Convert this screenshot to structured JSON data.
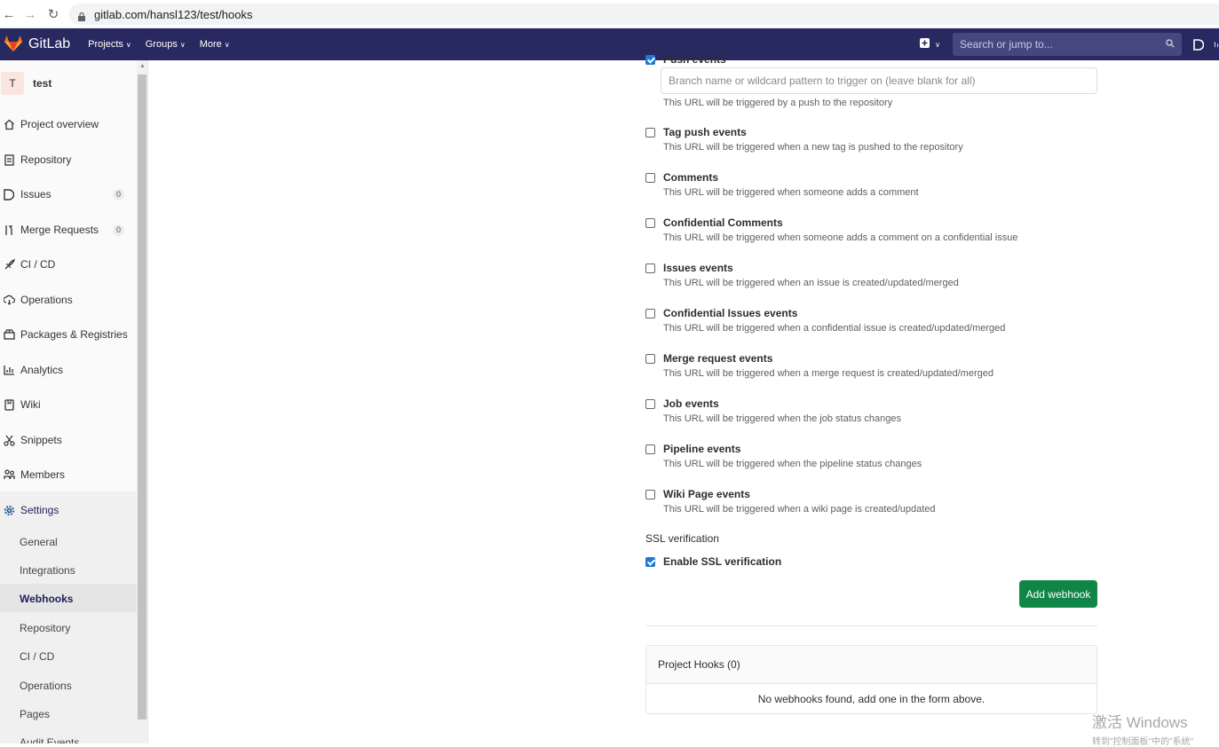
{
  "browser": {
    "url": "gitlab.com/hansl123/test/hooks"
  },
  "navbar": {
    "brand": "GitLab",
    "menus": [
      "Projects",
      "Groups",
      "More"
    ],
    "search_placeholder": "Search or jump to..."
  },
  "sidebar": {
    "project_initial": "T",
    "project_name": "test",
    "items": [
      {
        "label": "Project overview",
        "icon": "home-icon"
      },
      {
        "label": "Repository",
        "icon": "doc-icon"
      },
      {
        "label": "Issues",
        "icon": "issues-icon",
        "count": "0"
      },
      {
        "label": "Merge Requests",
        "icon": "merge-icon",
        "count": "0"
      },
      {
        "label": "CI / CD",
        "icon": "rocket-icon"
      },
      {
        "label": "Operations",
        "icon": "cloud-icon"
      },
      {
        "label": "Packages & Registries",
        "icon": "package-icon"
      },
      {
        "label": "Analytics",
        "icon": "chart-icon"
      },
      {
        "label": "Wiki",
        "icon": "book-icon"
      },
      {
        "label": "Snippets",
        "icon": "scissors-icon"
      },
      {
        "label": "Members",
        "icon": "users-icon"
      },
      {
        "label": "Settings",
        "icon": "gear-icon"
      }
    ],
    "settings_sub": [
      "General",
      "Integrations",
      "Webhooks",
      "Repository",
      "CI / CD",
      "Operations",
      "Pages",
      "Audit Events"
    ],
    "active_sub": "Webhooks"
  },
  "form": {
    "push_events": {
      "label": "Push events",
      "checked": true
    },
    "branch_placeholder": "Branch name or wildcard pattern to trigger on (leave blank for all)",
    "push_desc": "This URL will be triggered by a push to the repository",
    "events": [
      {
        "label": "Tag push events",
        "desc": "This URL will be triggered when a new tag is pushed to the repository"
      },
      {
        "label": "Comments",
        "desc": "This URL will be triggered when someone adds a comment"
      },
      {
        "label": "Confidential Comments",
        "desc": "This URL will be triggered when someone adds a comment on a confidential issue"
      },
      {
        "label": "Issues events",
        "desc": "This URL will be triggered when an issue is created/updated/merged"
      },
      {
        "label": "Confidential Issues events",
        "desc": "This URL will be triggered when a confidential issue is created/updated/merged"
      },
      {
        "label": "Merge request events",
        "desc": "This URL will be triggered when a merge request is created/updated/merged"
      },
      {
        "label": "Job events",
        "desc": "This URL will be triggered when the job status changes"
      },
      {
        "label": "Pipeline events",
        "desc": "This URL will be triggered when the pipeline status changes"
      },
      {
        "label": "Wiki Page events",
        "desc": "This URL will be triggered when a wiki page is created/updated"
      }
    ],
    "ssl_heading": "SSL verification",
    "ssl_checkbox": "Enable SSL verification",
    "submit": "Add webhook"
  },
  "hooks": {
    "title": "Project Hooks (0)",
    "empty": "No webhooks found, add one in the form above."
  },
  "watermark": {
    "line1": "激活 Windows",
    "line2": "转到\"控制面板\"中的\"系统\""
  },
  "colors": {
    "navbar": "#292961",
    "primary_button": "#108548",
    "checkbox_checked": "#1f78d1"
  }
}
